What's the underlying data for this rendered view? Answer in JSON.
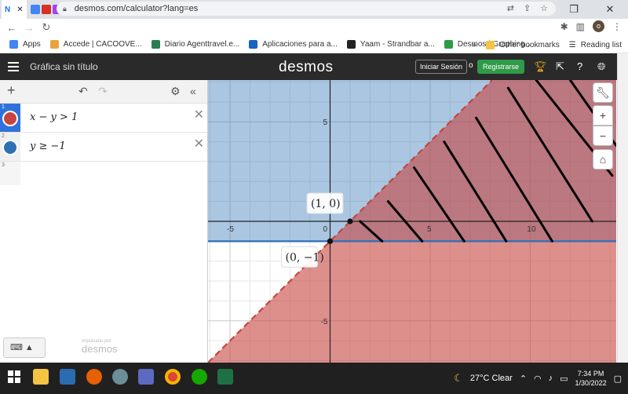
{
  "browser": {
    "active_tab_initial": "N",
    "url": "desmos.com/calculator?lang=es",
    "bookmarks": [
      {
        "label": "Apps",
        "icon_color": "#4285f4"
      },
      {
        "label": "Accede | CACOOVE...",
        "icon_color": "#e8a33d"
      },
      {
        "label": "Diario Agenttravel.e...",
        "icon_color": "#2a7d4f"
      },
      {
        "label": "Aplicaciones para a...",
        "icon_color": "#1565c0"
      },
      {
        "label": "Yaam - Strandbar a...",
        "icon_color": "#222222"
      },
      {
        "label": "Desmos | Graphing...",
        "icon_color": "#2f9a48"
      }
    ],
    "other_bookmarks": "Other bookmarks",
    "reading_list": "Reading list",
    "profile_initial": "o"
  },
  "desmos": {
    "graph_title": "Gráfica sin título",
    "logo": "desmos",
    "signin_label": "Iniciar Sesión",
    "or_label": "o",
    "register_label": "Registrarse",
    "expressions": [
      {
        "index": "1",
        "latex": "x − y > 1",
        "color": "#c74440"
      },
      {
        "index": "2",
        "latex": "y ≥ −1",
        "color": "#2d70b3"
      }
    ],
    "empty_index": "3",
    "powered_by_small": "impulsado por",
    "powered_by_big": "desmos",
    "keyboard_label": "⌨ ▲",
    "point_labels": [
      "(1, 0)",
      "(0, −1)"
    ]
  },
  "chart_data": {
    "type": "scatter",
    "title": "",
    "x_ticks": [
      "-5",
      "0",
      "5",
      "10"
    ],
    "y_ticks": [
      "5",
      "-5"
    ],
    "xlim": [
      -6.1,
      14.3
    ],
    "ylim": [
      -7.1,
      7.1
    ],
    "grid": true,
    "regions": [
      {
        "inequality": "x - y > 1",
        "color": "#c74440",
        "boundary": "dashed"
      },
      {
        "inequality": "y >= -1",
        "color": "#2d70b3",
        "boundary": "solid"
      }
    ],
    "points": [
      {
        "x": 1,
        "y": 0,
        "label": "(1, 0)"
      },
      {
        "x": 0,
        "y": -1,
        "label": "(0, -1)"
      }
    ],
    "annotation": "hand-drawn hatching lines over the overlap region"
  },
  "taskbar": {
    "weather": "27°C  Clear",
    "time": "7:34 PM",
    "date": "1/30/2022"
  }
}
